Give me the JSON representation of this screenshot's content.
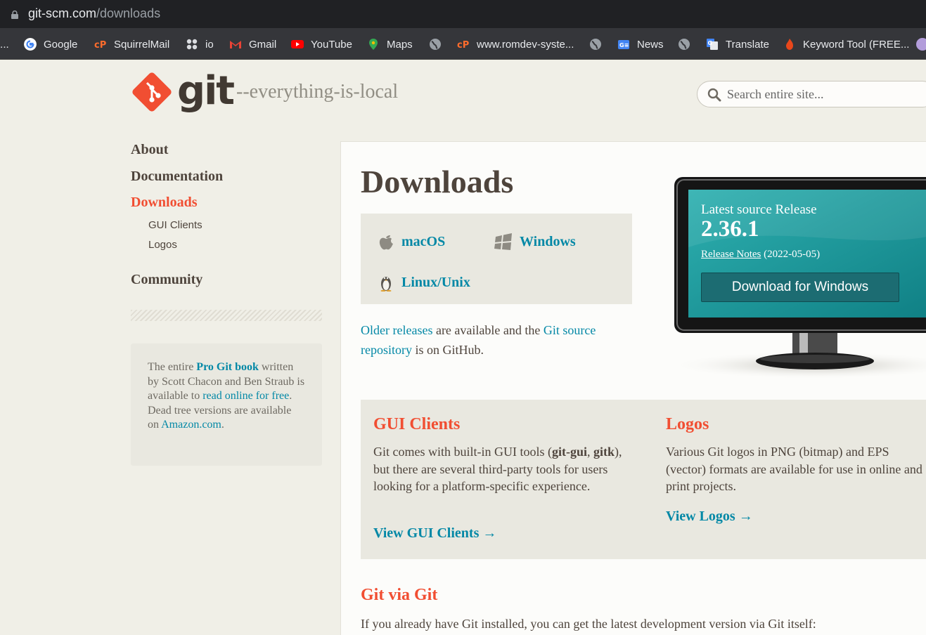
{
  "browser": {
    "url_host": "git-scm.com",
    "url_path": "/downloads",
    "bookmarks": [
      {
        "label": "t...",
        "icon": "tab-fragment-icon"
      },
      {
        "label": "Google",
        "icon": "google-icon"
      },
      {
        "label": "SquirrelMail",
        "icon": "cpanel-icon"
      },
      {
        "label": "io",
        "icon": "apps-grid-icon"
      },
      {
        "label": "Gmail",
        "icon": "gmail-icon"
      },
      {
        "label": "YouTube",
        "icon": "youtube-icon"
      },
      {
        "label": "Maps",
        "icon": "maps-pin-icon"
      },
      {
        "label": "",
        "icon": "globe-icon"
      },
      {
        "label": "www.romdev-syste...",
        "icon": "cpanel-icon"
      },
      {
        "label": "",
        "icon": "globe-icon"
      },
      {
        "label": "News",
        "icon": "google-news-icon"
      },
      {
        "label": "",
        "icon": "globe-icon"
      },
      {
        "label": "Translate",
        "icon": "google-translate-icon"
      },
      {
        "label": "Keyword Tool (FREE...",
        "icon": "keyword-tool-icon"
      }
    ]
  },
  "header": {
    "logo_word": "git",
    "tagline": "--everything-is-local",
    "search_placeholder": "Search entire site..."
  },
  "sidebar": {
    "items": [
      {
        "label": "About"
      },
      {
        "label": "Documentation"
      },
      {
        "label": "Downloads"
      },
      {
        "label": "Community"
      }
    ],
    "subitems": [
      {
        "label": "GUI Clients"
      },
      {
        "label": "Logos"
      }
    ],
    "book": {
      "t1": "The entire ",
      "pro_git": "Pro Git book",
      "t2": " written by Scott Chacon and Ben Straub is available to ",
      "read_online": "read online for free",
      "t3": ". Dead tree versions are available on ",
      "amazon": "Amazon.com",
      "t4": "."
    }
  },
  "main": {
    "title": "Downloads",
    "platforms": {
      "macos": "macOS",
      "windows": "Windows",
      "linux": "Linux/Unix"
    },
    "older": {
      "older_releases": "Older releases",
      "t1": " are available and the ",
      "git_source": "Git source repository",
      "t2": " is on GitHub."
    },
    "release": {
      "label": "Latest source Release",
      "version": "2.36.1",
      "notes_link": "Release Notes",
      "date": " (2022-05-05)",
      "download_button": "Download for Windows"
    },
    "gui": {
      "title": "GUI Clients",
      "t1": "Git comes with built-in GUI tools (",
      "b1": "git-gui",
      "t2": ", ",
      "b2": "gitk",
      "t3": "), but there are several third-party tools for users looking for a platform-specific experience.",
      "link": "View GUI Clients →"
    },
    "logos": {
      "title": "Logos",
      "text": "Various Git logos in PNG (bitmap) and EPS (vector) formats are available for use in online and print projects.",
      "link": "View Logos →"
    },
    "git_via_git": {
      "title": "Git via Git",
      "text": "If you already have Git installed, you can get the latest development version via Git itself:"
    }
  },
  "colors": {
    "accent": "#f14e32",
    "link": "#0388a6",
    "text": "#4e443c",
    "screen": "#1a9a9d"
  }
}
